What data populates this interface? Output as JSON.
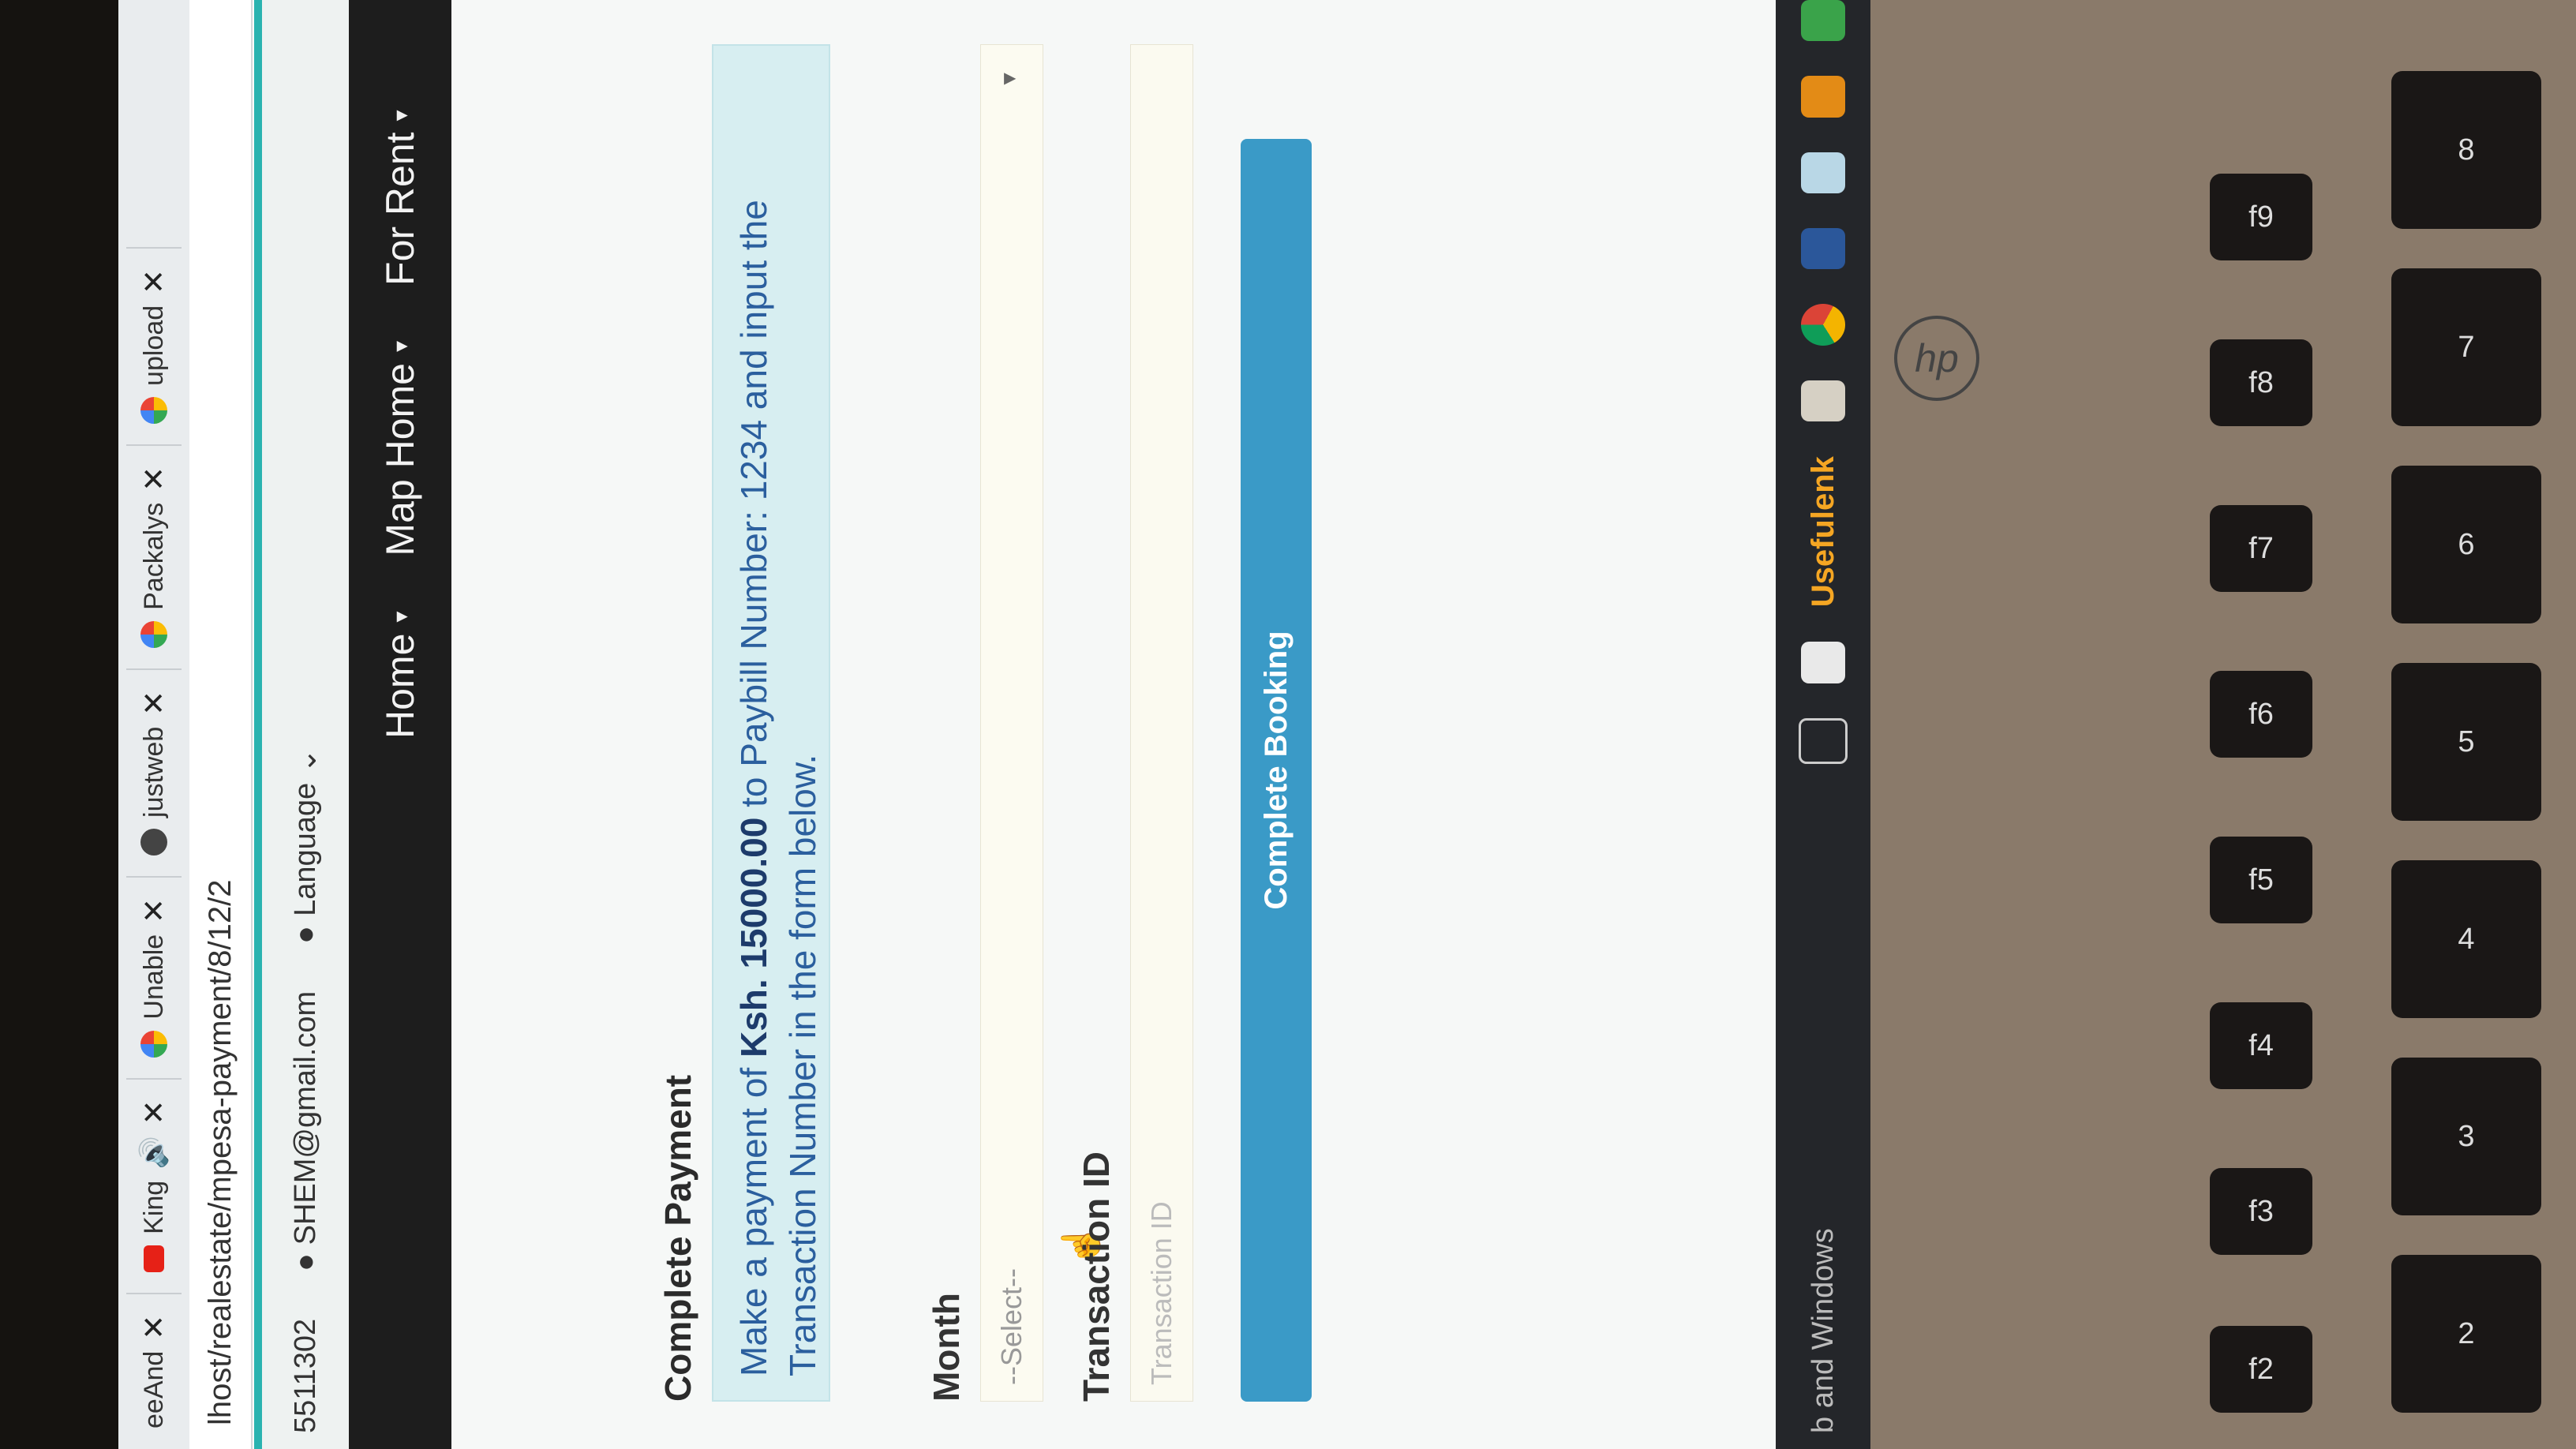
{
  "browser": {
    "tabs": [
      {
        "label": "eeAnd",
        "icon": "page-icon"
      },
      {
        "label": "King",
        "icon": "youtube-icon",
        "audio": true
      },
      {
        "label": "Unable",
        "icon": "google-icon"
      },
      {
        "label": "justweb",
        "icon": "globe-icon"
      },
      {
        "label": "Packalys",
        "icon": "google-icon"
      },
      {
        "label": "upload",
        "icon": "google-icon"
      }
    ],
    "address": "lhost/realestate/mpesa-payment/8/12/2"
  },
  "topbar": {
    "phone": "5511302",
    "email": "SHEM@gmail.com",
    "language": "Language"
  },
  "nav": {
    "items": [
      "Home",
      "Map Home",
      "For Rent"
    ]
  },
  "form": {
    "title": "Complete Payment",
    "info_prefix": "Make a payment of ",
    "info_amount": "Ksh. 15000.00",
    "info_middle": " to Paybill Number: 1234 and input the Transaction Number in the form below.",
    "month_label": "Month",
    "month_value": "--Select--",
    "txn_label": "Transaction ID",
    "txn_placeholder": "Transaction ID",
    "submit_label": "Complete Booking"
  },
  "taskbar": {
    "search_text": "b and Windows",
    "useful_text": "Usefulenk"
  },
  "keyboard": {
    "brand": "hp",
    "keys": [
      "2",
      "3",
      "4",
      "5",
      "6",
      "7",
      "8",
      "f2",
      "f3",
      "f4",
      "f5",
      "f6",
      "f7",
      "f8",
      "f9"
    ]
  },
  "colors": {
    "accent": "#2ab3b0",
    "button": "#3a9ac7",
    "info_bg": "#d7eef1",
    "navbar": "#1d1d1d"
  }
}
